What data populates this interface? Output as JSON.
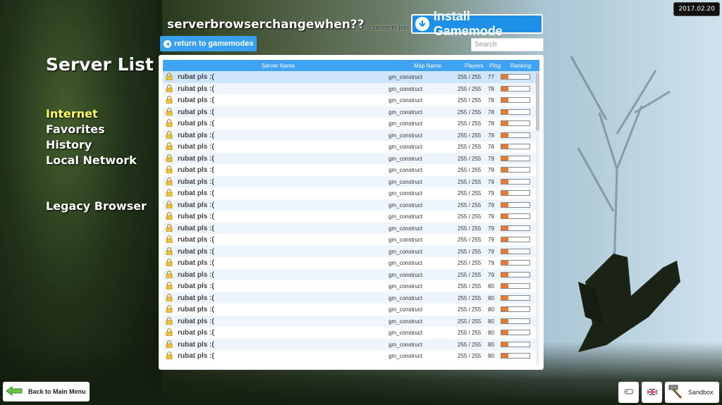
{
  "date": "2017.02.20",
  "header": {
    "title": "serverbrowserchangewhen??",
    "hint": "pick a server to join",
    "install_label": "Install Gamemode",
    "return_label": "return to gamemodes",
    "search_placeholder": "Search"
  },
  "sidebar": {
    "title": "Server List",
    "items": [
      {
        "label": "Internet"
      },
      {
        "label": "Favorites"
      },
      {
        "label": "History"
      },
      {
        "label": "Local Network"
      }
    ],
    "legacy_label": "Legacy Browser"
  },
  "table": {
    "columns": {
      "name": "Server Name",
      "map": "Map Name",
      "players": "Players",
      "ping": "Ping",
      "ranking": "Ranking"
    },
    "rows": [
      {
        "name": "rubat pls :(",
        "map": "gm_construct",
        "players": "255 / 255",
        "ping": "77"
      },
      {
        "name": "rubat pls :(",
        "map": "gm_construct",
        "players": "255 / 255",
        "ping": "78"
      },
      {
        "name": "rubat pls :(",
        "map": "gm_construct",
        "players": "255 / 255",
        "ping": "78"
      },
      {
        "name": "rubat pls :(",
        "map": "gm_construct",
        "players": "255 / 255",
        "ping": "78"
      },
      {
        "name": "rubat pls :(",
        "map": "gm_construct",
        "players": "255 / 255",
        "ping": "78"
      },
      {
        "name": "rubat pls :(",
        "map": "gm_construct",
        "players": "255 / 255",
        "ping": "78"
      },
      {
        "name": "rubat pls :(",
        "map": "gm_construct",
        "players": "255 / 255",
        "ping": "78"
      },
      {
        "name": "rubat pls :(",
        "map": "gm_construct",
        "players": "255 / 255",
        "ping": "79"
      },
      {
        "name": "rubat pls :(",
        "map": "gm_construct",
        "players": "255 / 255",
        "ping": "79"
      },
      {
        "name": "rubat pls :(",
        "map": "gm_construct",
        "players": "255 / 255",
        "ping": "79"
      },
      {
        "name": "rubat pls :(",
        "map": "gm_construct",
        "players": "255 / 255",
        "ping": "79"
      },
      {
        "name": "rubat pls :(",
        "map": "gm_construct",
        "players": "255 / 255",
        "ping": "79"
      },
      {
        "name": "rubat pls :(",
        "map": "gm_construct",
        "players": "255 / 255",
        "ping": "79"
      },
      {
        "name": "rubat pls :(",
        "map": "gm_construct",
        "players": "255 / 255",
        "ping": "79"
      },
      {
        "name": "rubat pls :(",
        "map": "gm_construct",
        "players": "255 / 255",
        "ping": "79"
      },
      {
        "name": "rubat pls :(",
        "map": "gm_construct",
        "players": "255 / 255",
        "ping": "79"
      },
      {
        "name": "rubat pls :(",
        "map": "gm_construct",
        "players": "255 / 255",
        "ping": "79"
      },
      {
        "name": "rubat pls :(",
        "map": "gm_construct",
        "players": "255 / 255",
        "ping": "79"
      },
      {
        "name": "rubat pls :(",
        "map": "gm_construct",
        "players": "255 / 255",
        "ping": "80"
      },
      {
        "name": "rubat pls :(",
        "map": "gm_construct",
        "players": "255 / 255",
        "ping": "80"
      },
      {
        "name": "rubat pls :(",
        "map": "gm_construct",
        "players": "255 / 255",
        "ping": "80"
      },
      {
        "name": "rubat pls :(",
        "map": "gm_construct",
        "players": "255 / 255",
        "ping": "80"
      },
      {
        "name": "rubat pls :(",
        "map": "gm_construct",
        "players": "255 / 255",
        "ping": "80"
      },
      {
        "name": "rubat pls :(",
        "map": "gm_construct",
        "players": "255 / 255",
        "ping": "80"
      },
      {
        "name": "rubat pls :(",
        "map": "gm_construct",
        "players": "255 / 255",
        "ping": "80"
      }
    ],
    "ranking_fraction": 0.25
  },
  "footer": {
    "back_label": "Back to Main Menu",
    "sandbox_label": "Sandbox"
  },
  "colors": {
    "accent": "#1e90e8",
    "header_bar": "#3fa2f2",
    "active_item": "#ffff66",
    "rank_fill": "#e67a2e"
  },
  "icons": [
    "download-icon",
    "arrow-left-circle-icon",
    "lock-icon",
    "back-arrow-icon",
    "gamepad-icon",
    "uk-flag-icon",
    "hammer-icon"
  ]
}
